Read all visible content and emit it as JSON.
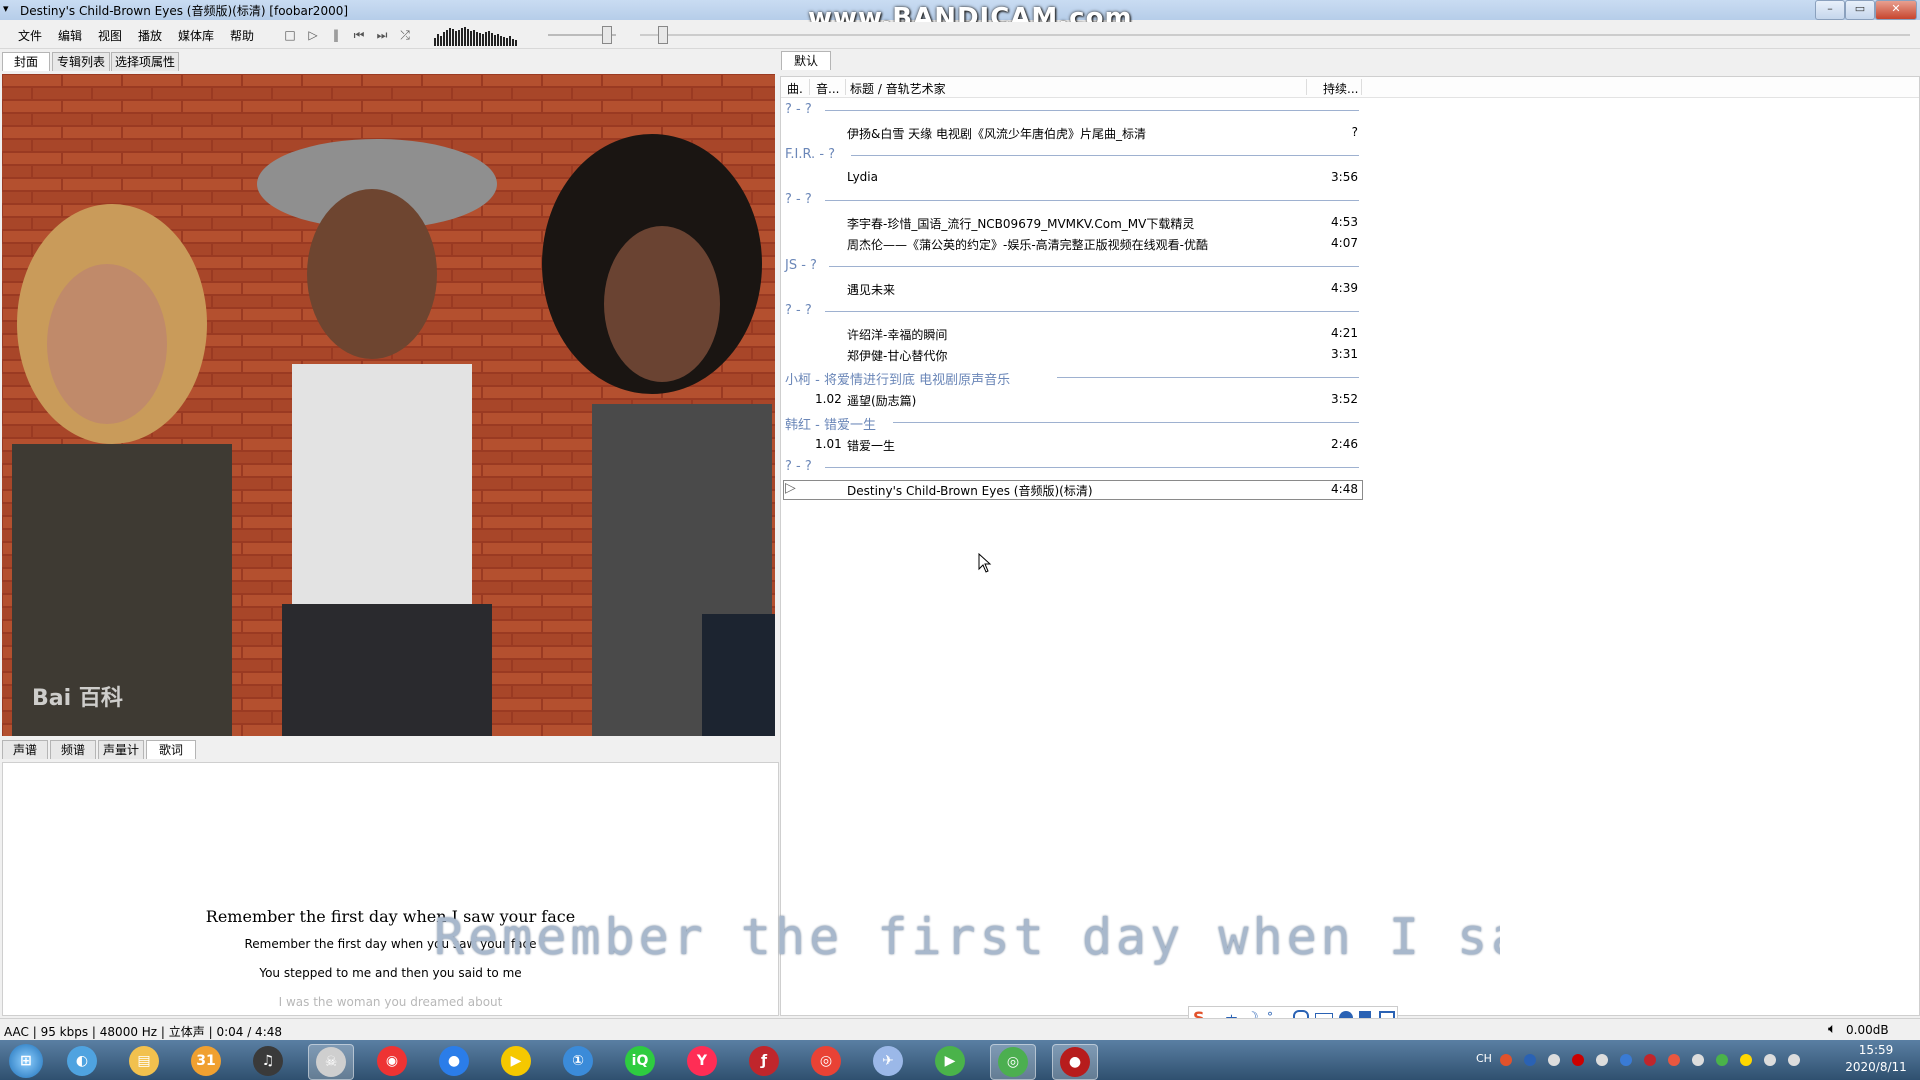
{
  "window": {
    "title": "Destiny's Child-Brown Eyes (音频版)(标清)  [foobar2000]",
    "watermark": "www.BANDICAM.com"
  },
  "menu": [
    "文件",
    "编辑",
    "视图",
    "播放",
    "媒体库",
    "帮助"
  ],
  "toolbar": {
    "buttons": [
      "stop-icon",
      "play-icon",
      "pause-icon",
      "previous-icon",
      "next-icon",
      "random-icon"
    ],
    "volume_level": 0.85,
    "seek_fraction": 0.014
  },
  "left_tabs": [
    "封面",
    "专辑列表",
    "选择项属性"
  ],
  "cover": {
    "watermark": "Bai 百科"
  },
  "bottom_tabs": [
    "声谱",
    "频谱",
    "声量计",
    "歌词"
  ],
  "lyrics": {
    "current": "Remember the first day when I saw your face",
    "lines": [
      "Remember the first day when you saw your face",
      "You stepped to me and then you said to me",
      "I was the woman you dreamed about"
    ]
  },
  "desktop_lyric": "Remember the first day when I saw yo",
  "playlist": {
    "tab": "默认",
    "headers": [
      "曲.",
      "音...",
      "标题 / 音轨艺术家",
      "持续..."
    ],
    "groups": [
      {
        "name": "? - ?",
        "tracks": [
          {
            "no": "",
            "title": "伊扬&白雪 天缘 电视剧《风流少年唐伯虎》片尾曲_标清",
            "duration": "?"
          }
        ]
      },
      {
        "name": "F.I.R. - ?",
        "tracks": [
          {
            "no": "",
            "title": "Lydia",
            "duration": "3:56"
          }
        ]
      },
      {
        "name": "? - ?",
        "tracks": [
          {
            "no": "",
            "title": "李宇春-珍惜_国语_流行_NCB09679_MVMKV.Com_MV下载精灵",
            "duration": "4:53"
          },
          {
            "no": "",
            "title": "周杰伦——《蒲公英的约定》-娱乐-高清完整正版视频在线观看-优酷",
            "duration": "4:07"
          }
        ]
      },
      {
        "name": "JS - ?",
        "tracks": [
          {
            "no": "",
            "title": "遇见未来",
            "duration": "4:39"
          }
        ]
      },
      {
        "name": "? - ?",
        "tracks": [
          {
            "no": "",
            "title": "许绍洋-幸福的瞬间",
            "duration": "4:21"
          },
          {
            "no": "",
            "title": "郑伊健-甘心替代你",
            "duration": "3:31"
          }
        ]
      },
      {
        "name": "小柯 - 将爱情进行到底 电视剧原声音乐",
        "tracks": [
          {
            "no": "1.02",
            "title": "遥望(励志篇)",
            "duration": "3:52"
          }
        ]
      },
      {
        "name": "韩红 - 错爱一生",
        "tracks": [
          {
            "no": "1.01",
            "title": "错爱一生",
            "duration": "2:46"
          }
        ]
      },
      {
        "name": "? - ?",
        "tracks": [
          {
            "no": "",
            "title": "Destiny's Child-Brown Eyes (音频版)(标清)",
            "duration": "4:48",
            "playing": true
          }
        ]
      }
    ]
  },
  "status": {
    "info": "AAC | 95 kbps | 48000 Hz | 立体声 | 0:04 / 4:48",
    "volume": "0.00dB"
  },
  "ime": {
    "items": [
      "S",
      "中",
      "☽",
      "°,",
      "mic",
      "kbd",
      "user",
      "shirt",
      "grid"
    ]
  },
  "taskbar": {
    "apps": [
      "start-orb",
      "globe",
      "explorer",
      "calendar-31",
      "headphones",
      "alien",
      "netease-music",
      "chrome-like",
      "player",
      "info",
      "iqiyi",
      "youku",
      "flash",
      "chrome",
      "bird",
      "video",
      "green-player",
      "record"
    ],
    "tray_text": "CH",
    "time": "15:59",
    "date": "2020/8/11"
  },
  "colors": {
    "group_text": "#6b87b8",
    "title_bar": "#c9dcf2",
    "taskbar": "#3c6186"
  }
}
